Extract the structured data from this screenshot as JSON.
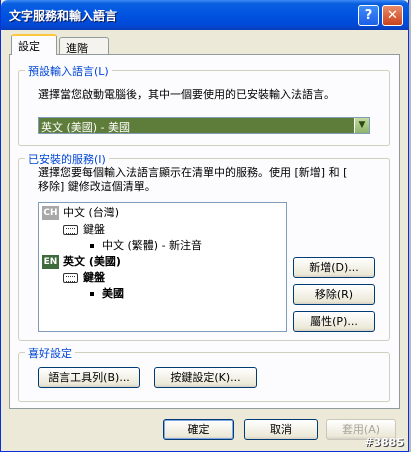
{
  "window": {
    "title": "文字服務和輸入語言",
    "help_glyph": "?",
    "close_glyph": "✕"
  },
  "tabs": [
    {
      "label": "設定",
      "active": true
    },
    {
      "label": "進階",
      "active": false
    }
  ],
  "default_input_language": {
    "title": "預設輸入語言(L)",
    "description": "選擇當您啟動電腦後，其中一個要使用的已安裝輸入法語言。",
    "selected": "英文 (美國) - 美國"
  },
  "installed_services": {
    "title": "已安裝的服務(I)",
    "description_line1": "選擇您要每個輸入法語言顯示在清單中的服務。使用 [新增] 和 [",
    "description_line2": "移除] 鍵修改這個清單。",
    "tree": [
      {
        "badge": "CH",
        "language": "中文 (台灣)",
        "category": "鍵盤",
        "item": "中文 (繁體) - 新注音"
      },
      {
        "badge": "EN",
        "language": "英文 (美國)",
        "category": "鍵盤",
        "item": "美國"
      }
    ],
    "add_button": "新增(D)...",
    "remove_button": "移除(R)",
    "properties_button": "屬性(P)..."
  },
  "preferences": {
    "title": "喜好設定",
    "language_bar_button": "語言工具列(B)...",
    "key_settings_button": "按鍵設定(K)..."
  },
  "footer": {
    "ok_button": "確定",
    "cancel_button": "取消",
    "apply_button": "套用(A)"
  },
  "watermark": "#3885",
  "colors": {
    "titlebar": "#0053e0",
    "group_title": "#0046d5",
    "combo_selection": "#5e7c3a",
    "tab_highlight": "#ffc73c"
  }
}
